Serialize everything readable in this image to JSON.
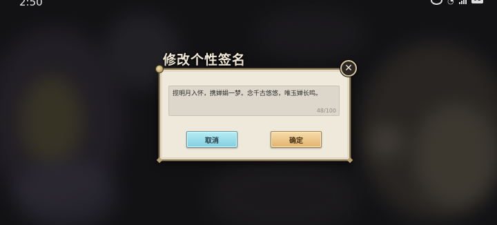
{
  "status_bar": {
    "time": "2:50",
    "battery": "61"
  },
  "dialog": {
    "title": "修改个性签名",
    "signature_value": "揽明月入怀，携婵娟一梦。念千古悠悠，唯玉婵长鸣。",
    "char_counter": "48/100",
    "cancel_label": "取消",
    "confirm_label": "确定",
    "close_icon": "close-icon"
  },
  "colors": {
    "cancel_button": "#9fe0ec",
    "confirm_button": "#eec88a",
    "panel": "#efe9dc"
  }
}
